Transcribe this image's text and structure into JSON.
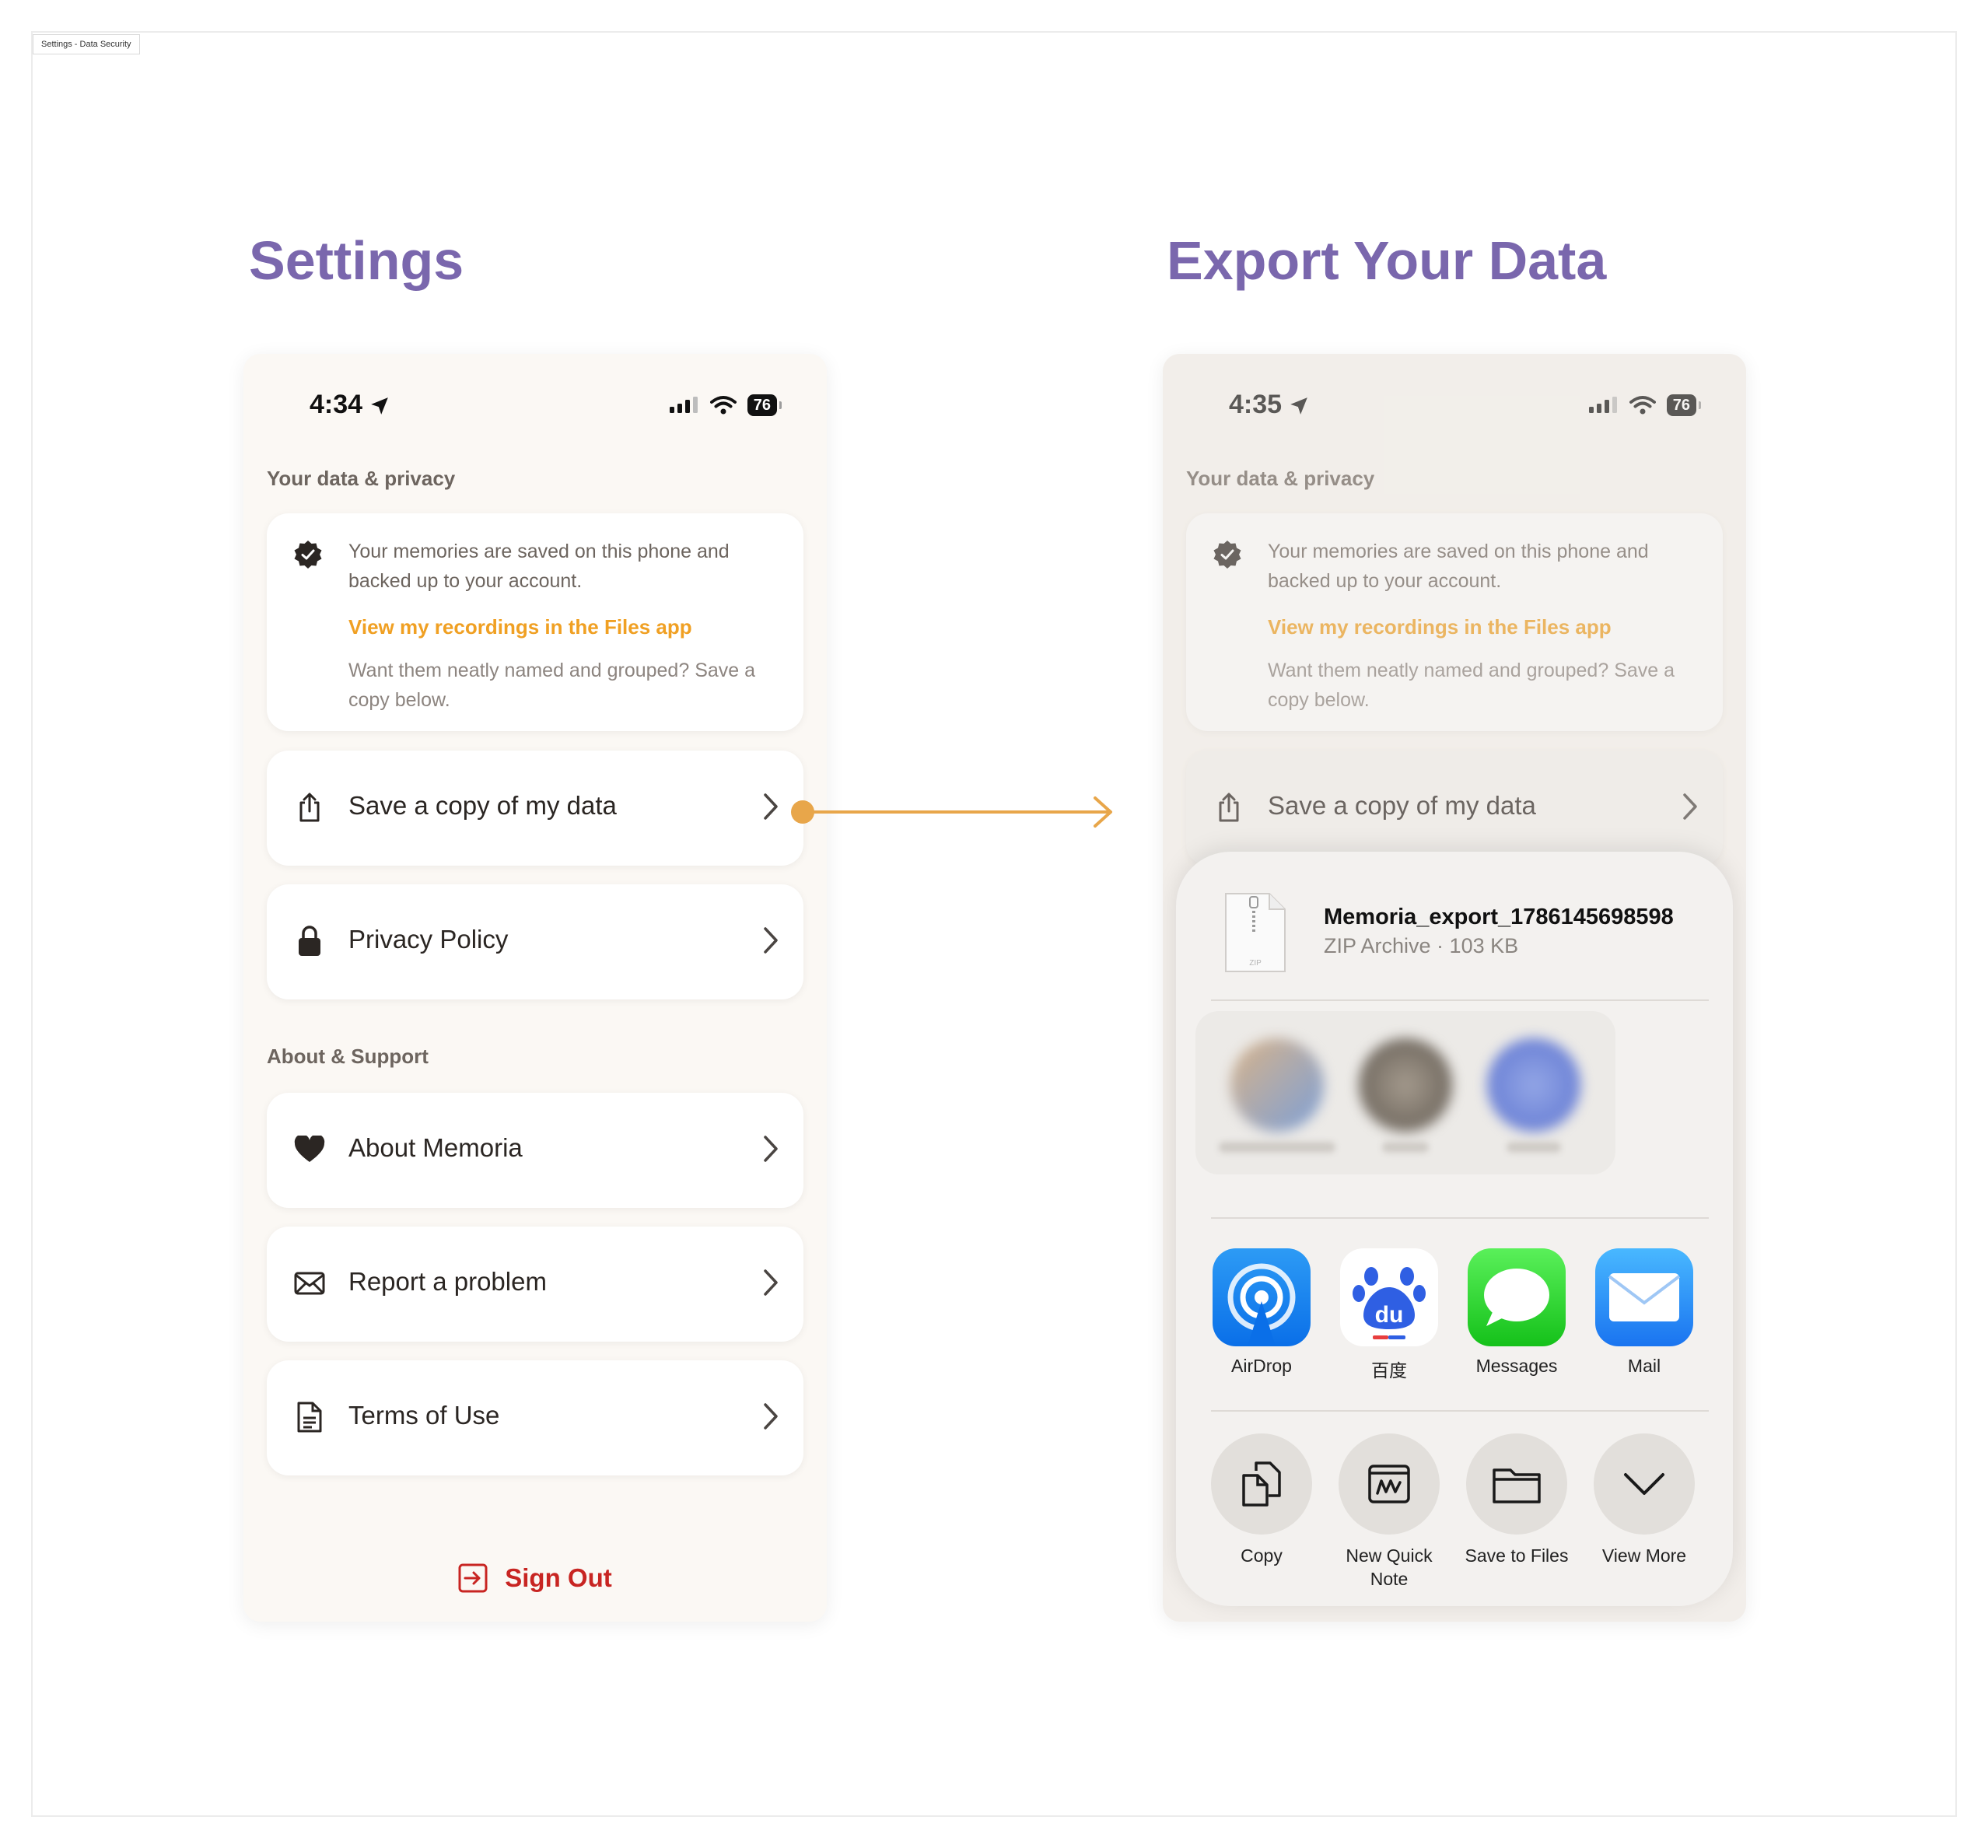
{
  "frame_tag": "Settings - Data Security",
  "titles": {
    "left": "Settings",
    "right": "Export Your Data"
  },
  "left_screen": {
    "status": {
      "time": "4:34",
      "battery": "76"
    },
    "section_privacy": "Your data & privacy",
    "info": {
      "text": "Your memories are saved on this phone and backed up to your account.",
      "link": "View my recordings in the Files app",
      "sub": "Want them neatly named and grouped? Save a copy below."
    },
    "rows": {
      "save_copy": "Save a copy of my data",
      "privacy_policy": "Privacy Policy",
      "about": "About Memoria",
      "report": "Report a problem",
      "terms": "Terms of Use"
    },
    "section_support": "About & Support",
    "sign_out": "Sign Out"
  },
  "right_screen": {
    "status": {
      "time": "4:35",
      "battery": "76"
    },
    "section_privacy": "Your data & privacy",
    "info": {
      "text": "Your memories are saved on this phone and backed up to your account.",
      "link": "View my recordings in the Files app",
      "sub": "Want them neatly named and grouped? Save a copy below."
    },
    "save_copy": "Save a copy of my data",
    "share_sheet": {
      "file_name": "Memoria_export_1786145698598",
      "file_meta": "ZIP Archive · 103 KB",
      "zip_icon_label": "ZIP",
      "apps": [
        "AirDrop",
        "百度",
        "Messages",
        "Mail"
      ],
      "actions": [
        "Copy",
        "New Quick Note",
        "Save to Files",
        "View More"
      ]
    }
  },
  "colors": {
    "title": "#7a67ad",
    "link": "#f0a023",
    "sign_out": "#c82522",
    "connector": "#e8a64a",
    "phone_bg": "#fbf8f4"
  }
}
